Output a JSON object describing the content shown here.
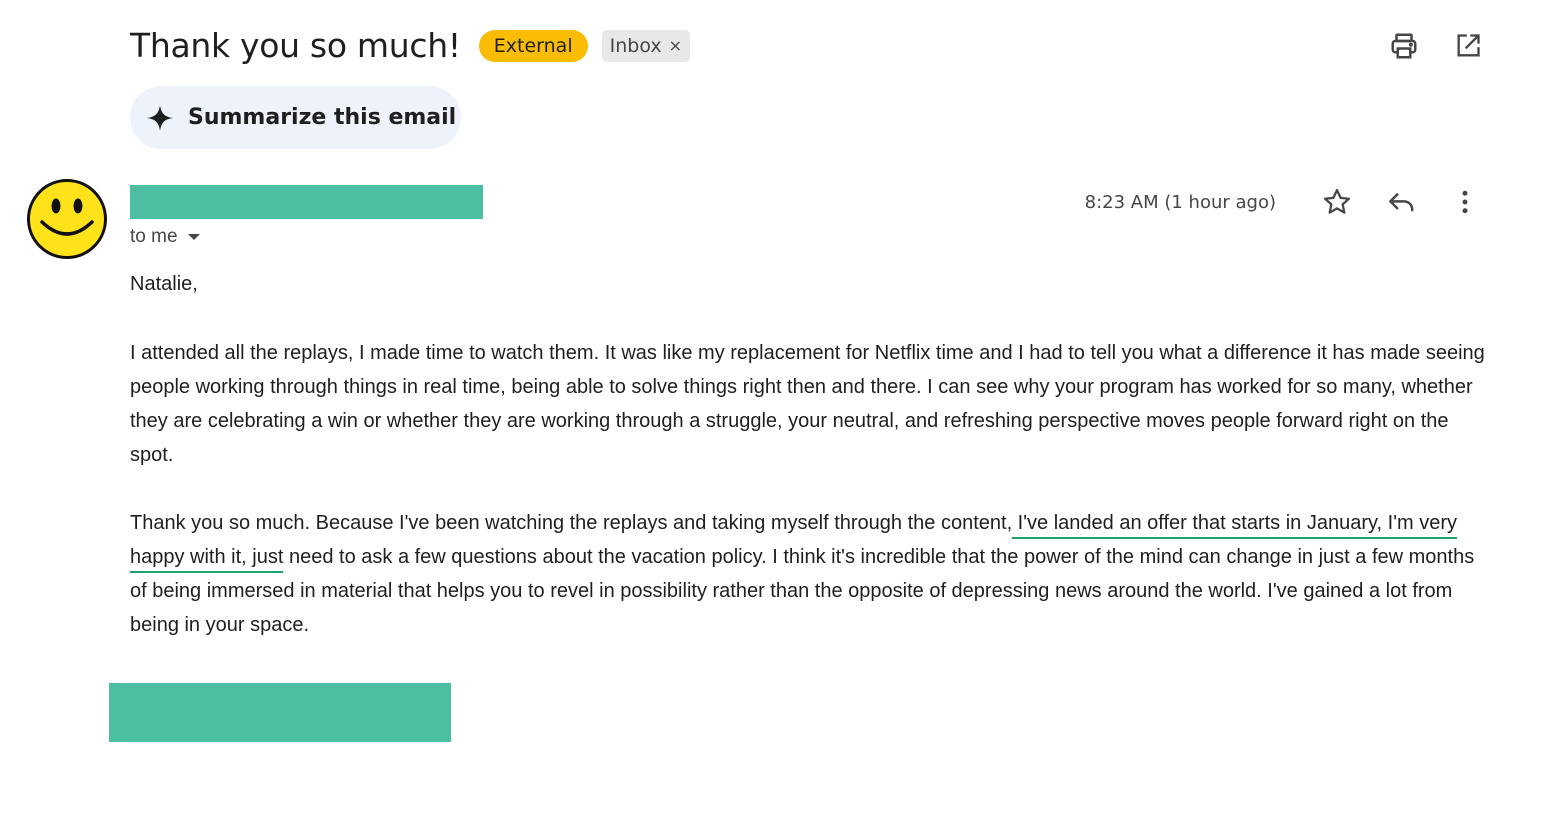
{
  "email": {
    "subject": "Thank you so much!",
    "labels": {
      "external": "External",
      "inbox": "Inbox",
      "remove_label": "×"
    },
    "summarize_label": "Summarize this email",
    "recipient": "to me",
    "timestamp": "8:23 AM (1 hour ago)",
    "greeting": "Natalie,",
    "paragraph1": "I attended all the replays, I made time to watch them. It was like my replacement for Netflix time and I had to tell you what a difference it has made seeing people working through things in real time, being able to solve things right then and there. I can see why your program has worked for so many, whether they are celebrating a win or whether they are working through a struggle, your neutral, and refreshing perspective moves people forward right on the spot.",
    "paragraph2_before": "Thank you so much. Because I've been watching the replays and taking myself through the content,",
    "paragraph2_highlight": " I've landed an offer that starts in January, I'm very happy with it, just",
    "paragraph2_after": " need to ask a few questions about the vacation policy. I think it's incredible that the power of the mind can change in just a few months of being immersed in material that helps you to revel in possibility rather than the opposite of depressing news around the world. I've gained a lot from being in your space."
  },
  "icons": {
    "print": "print-icon",
    "open_new_window": "open-in-new-window-icon",
    "sparkle": "sparkle-icon",
    "star": "star-icon",
    "reply": "reply-icon",
    "more": "more-vertical-icon",
    "avatar": "smiley-face-avatar"
  },
  "colors": {
    "external_badge": "#fbbc04",
    "inbox_badge": "#e8e8e8",
    "summarize_bg": "#eef2fb",
    "redaction": "#4cbfa2",
    "highlight_underline": "#1aa36d",
    "avatar_face": "#ffe21a"
  }
}
